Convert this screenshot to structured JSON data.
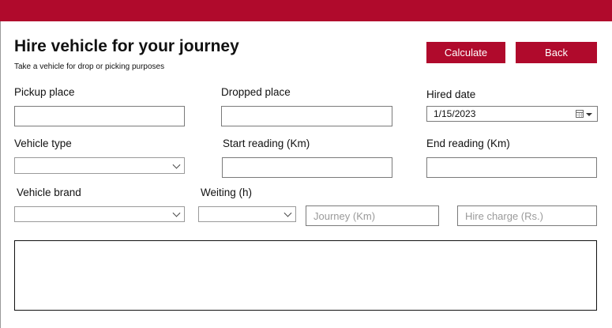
{
  "header": {
    "title": "Hire vehicle for your journey",
    "subtitle": "Take a vehicle for drop or picking purposes",
    "accent_color": "#b00a2c"
  },
  "buttons": {
    "calculate": "Calculate",
    "back": "Back"
  },
  "fields": {
    "pickup_place": {
      "label": "Pickup place",
      "value": ""
    },
    "dropped_place": {
      "label": "Dropped place",
      "value": ""
    },
    "hired_date": {
      "label": "Hired date",
      "value": "1/15/2023",
      "icon": "calendar-icon"
    },
    "vehicle_type": {
      "label": "Vehicle type",
      "value": ""
    },
    "start_reading": {
      "label": "Start reading (Km)",
      "value": ""
    },
    "end_reading": {
      "label": "End reading (Km)",
      "value": ""
    },
    "vehicle_brand": {
      "label": "Vehicle brand",
      "value": ""
    },
    "waiting": {
      "label": "Weiting (h)",
      "value": ""
    },
    "journey": {
      "placeholder": "Journey (Km)",
      "value": ""
    },
    "hire_charge": {
      "placeholder": "Hire charge (Rs.)",
      "value": ""
    }
  },
  "output": {
    "value": ""
  }
}
